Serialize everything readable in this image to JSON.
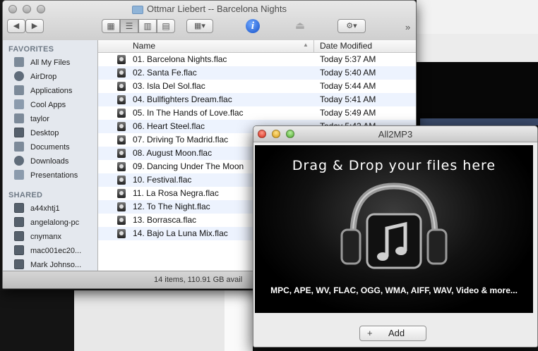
{
  "finder": {
    "title": "Ottmar Liebert -- Barcelona Nights",
    "sidebar": {
      "favorites_header": "FAVORITES",
      "favorites": [
        {
          "label": "All My Files",
          "icon": "all-files-icon"
        },
        {
          "label": "AirDrop",
          "icon": "airdrop-icon"
        },
        {
          "label": "Applications",
          "icon": "applications-icon"
        },
        {
          "label": "Cool Apps",
          "icon": "folder-icon"
        },
        {
          "label": "taylor",
          "icon": "home-icon"
        },
        {
          "label": "Desktop",
          "icon": "desktop-icon"
        },
        {
          "label": "Documents",
          "icon": "documents-icon"
        },
        {
          "label": "Downloads",
          "icon": "downloads-icon"
        },
        {
          "label": "Presentations",
          "icon": "folder-icon"
        }
      ],
      "shared_header": "SHARED",
      "shared": [
        {
          "label": "a44xhtj1",
          "icon": "computer-icon"
        },
        {
          "label": "angelalong-pc",
          "icon": "computer-icon"
        },
        {
          "label": "cnymanx",
          "icon": "computer-icon"
        },
        {
          "label": "mac001ec20...",
          "icon": "computer-icon"
        },
        {
          "label": "Mark Johnso...",
          "icon": "computer-icon"
        }
      ]
    },
    "columns": {
      "name": "Name",
      "date": "Date Modified"
    },
    "files": [
      {
        "name": "01. Barcelona Nights.flac",
        "date": "Today 5:37 AM"
      },
      {
        "name": "02. Santa Fe.flac",
        "date": "Today 5:40 AM"
      },
      {
        "name": "03. Isla Del Sol.flac",
        "date": "Today 5:44 AM"
      },
      {
        "name": "04. Bullfighters Dream.flac",
        "date": "Today 5:41 AM"
      },
      {
        "name": "05. In The Hands of Love.flac",
        "date": "Today 5:49 AM"
      },
      {
        "name": "06. Heart Steel.flac",
        "date": "Today 5:42 AM"
      },
      {
        "name": "07. Driving To Madrid.flac",
        "date": ""
      },
      {
        "name": "08. August Moon.flac",
        "date": ""
      },
      {
        "name": "09. Dancing Under The Moon",
        "date": ""
      },
      {
        "name": "10. Festival.flac",
        "date": ""
      },
      {
        "name": "11. La Rosa Negra.flac",
        "date": ""
      },
      {
        "name": "12. To The Night.flac",
        "date": ""
      },
      {
        "name": "13. Borrasca.flac",
        "date": ""
      },
      {
        "name": "14. Bajo La Luna Mix.flac",
        "date": ""
      }
    ],
    "status": "14 items, 110.91 GB avail"
  },
  "all2mp3": {
    "title": "All2MP3",
    "drop_title": "Drag & Drop your files here",
    "formats": "MPC, APE, WV, FLAC, OGG, WMA, AIFF, WAV, Video & more...",
    "add_label": "Add",
    "add_icon": "+"
  }
}
